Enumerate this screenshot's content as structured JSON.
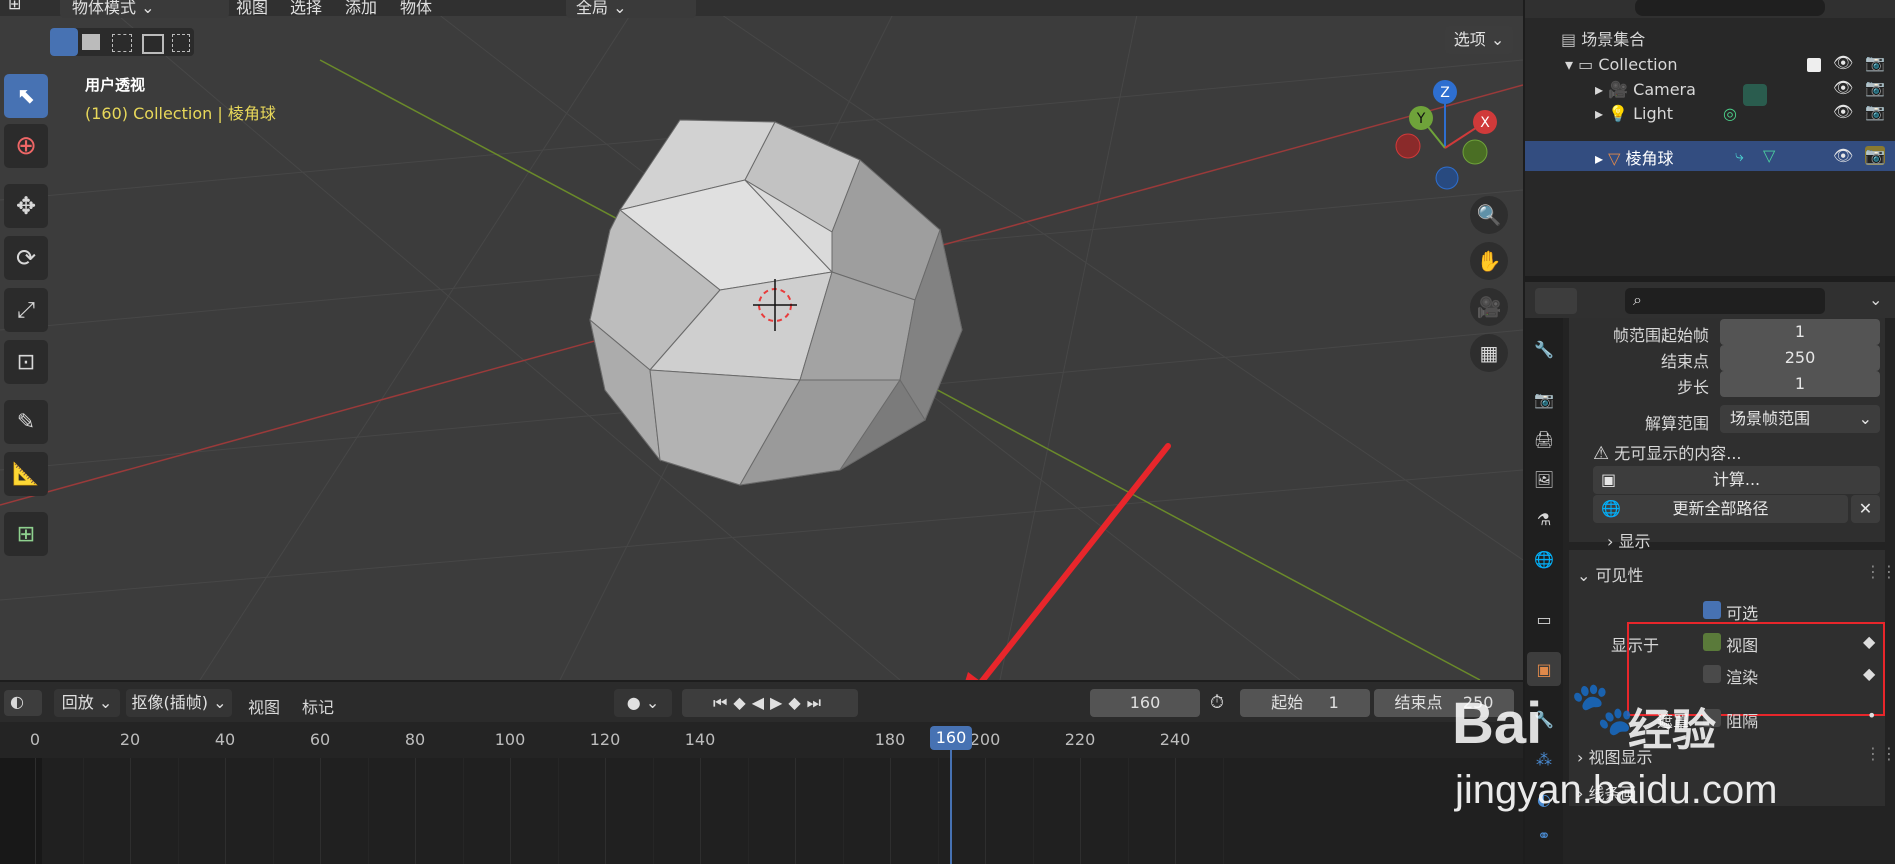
{
  "viewport": {
    "header": {
      "mode": "物体模式",
      "menus": [
        "视图",
        "选择",
        "添加",
        "物体"
      ],
      "transform": "全局",
      "options": "选项"
    },
    "view_name": "用户透视",
    "collection_info": "(160) Collection | 棱角球",
    "gizmo": {
      "z": "Z",
      "y": "Y",
      "x": "X"
    }
  },
  "outliner": {
    "root": "场景集合",
    "items": [
      {
        "label": "Collection"
      },
      {
        "label": "Camera"
      },
      {
        "label": "Light"
      },
      {
        "label": "棱角球"
      }
    ]
  },
  "properties": {
    "fields": [
      {
        "label": "帧范围起始帧",
        "value": "1"
      },
      {
        "label": "结束点",
        "value": "250"
      },
      {
        "label": "步长",
        "value": "1"
      }
    ],
    "calc_range": {
      "label": "解算范围",
      "value": "场景帧范围"
    },
    "warning": "无可显示的内容...",
    "calc_button": "计算...",
    "update_button": "更新全部路径",
    "display_section": "显示",
    "visibility_section": "可见性",
    "selectable": "可选",
    "show_in": "显示于",
    "viewport_label": "视图",
    "render_label": "渲染",
    "holdout": "遮罩",
    "holdout_value": "阻隔",
    "viewport_display_section": "视图显示",
    "next_section": "线条画"
  },
  "timeline": {
    "menus": [
      "回放",
      "抠像(插帧)",
      "视图",
      "标记"
    ],
    "current_frame": "160",
    "start_label": "起始",
    "start_value": "1",
    "end_label": "结束点",
    "end_value": "250",
    "ruler": [
      "0",
      "20",
      "40",
      "60",
      "80",
      "100",
      "120",
      "140",
      "160",
      "180",
      "200",
      "220",
      "240"
    ]
  },
  "watermark": {
    "brand": "Bai",
    "cn": "经验",
    "url": "jingyan.baidu.com"
  },
  "colors": {
    "accent": "#4772b3",
    "annotation": "#e8262b",
    "selected_row": "#334d80"
  }
}
